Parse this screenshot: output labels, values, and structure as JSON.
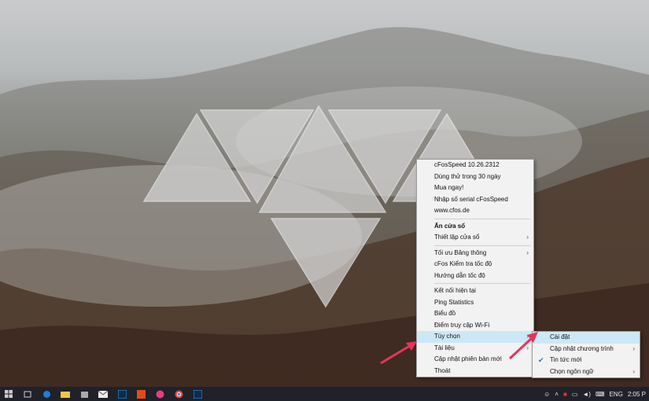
{
  "context_menu": {
    "items": [
      {
        "label": "cFosSpeed 10.26.2312"
      },
      {
        "label": "Dùng thử trong 30 ngày"
      },
      {
        "label": "Mua ngay!"
      },
      {
        "label": "Nhập số serial cFosSpeed"
      },
      {
        "label": "www.cfos.de"
      },
      {
        "label": "Ẩn cửa sổ"
      },
      {
        "label": "Thiết lập cửa sổ"
      },
      {
        "label": "Tối ưu Băng thông"
      },
      {
        "label": "cFos Kiểm tra tốc độ"
      },
      {
        "label": "Hướng dẫn tốc độ"
      },
      {
        "label": "Kết nối hiện tại"
      },
      {
        "label": "Ping Statistics"
      },
      {
        "label": "Biểu đồ"
      },
      {
        "label": "Điểm truy cập Wi-Fi"
      },
      {
        "label": "Tùy chọn"
      },
      {
        "label": "Tài liệu"
      },
      {
        "label": "Cập nhật phiên bản mới"
      },
      {
        "label": "Thoát"
      }
    ]
  },
  "submenu": {
    "items": [
      {
        "label": "Cài đặt"
      },
      {
        "label": "Cập nhật chương trình"
      },
      {
        "label": "Tin tức mới"
      },
      {
        "label": "Chọn ngôn ngữ"
      }
    ]
  },
  "tray": {
    "language": "ENG",
    "time": "2:05 P"
  },
  "colors": {
    "highlight": "#cce8f6",
    "arrow": "#e8335a",
    "taskbar": "#1f2228"
  },
  "icons": [
    "start-icon",
    "search-icon",
    "task-view-icon",
    "edge-icon",
    "file-explorer-icon",
    "store-icon",
    "mail-icon",
    "photoshop-icon",
    "office-icon",
    "app-icon",
    "chrome-icon",
    "photoshop-icon-2"
  ]
}
